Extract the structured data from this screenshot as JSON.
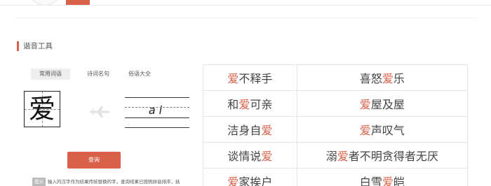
{
  "section": {
    "title": "谐音工具"
  },
  "tabs": [
    {
      "label": "常用词语",
      "active": true
    },
    {
      "label": "诗词名句",
      "active": false
    },
    {
      "label": "俗语大全",
      "active": false
    }
  ],
  "character": "爱",
  "pinyin": "ai",
  "query_label": "查询",
  "tip": {
    "badge": "提示",
    "text": "输入的汉字作为结果传统替换的字，查询结果已按照拼音排序，括"
  },
  "idioms": [
    [
      "爱不释手",
      "喜怒爱乐"
    ],
    [
      "和爱可亲",
      "爱屋及屋"
    ],
    [
      "洁身自爱",
      "爱声叹气"
    ],
    [
      "谈情说爱",
      "溺爱者不明贪得者无厌"
    ],
    [
      "爱家挨户",
      "白雪爱皑"
    ]
  ],
  "highlight_char": "爱",
  "colors": {
    "accent": "#d9614a",
    "tab_bg": "#eeeeee",
    "border": "#e5e5e5"
  },
  "icons": {
    "arrow": "airplane-icon"
  }
}
